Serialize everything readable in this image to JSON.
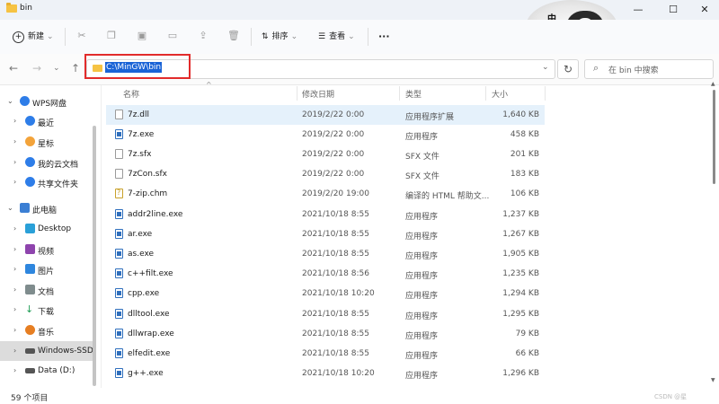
{
  "window": {
    "title": "bin",
    "minimize_glyph": "—",
    "maximize_glyph": "☐",
    "close_glyph": "✕"
  },
  "toolbar": {
    "new_label": "新建",
    "sort_label": "排序",
    "view_label": "查看",
    "more_label": "···"
  },
  "address": {
    "path": "C:\\MinGW\\bin",
    "search_placeholder": "在 bin 中搜索"
  },
  "avatar": {
    "char": "中",
    "small_text": "Ö"
  },
  "sidebar": {
    "items": [
      {
        "label": "WPS网盘",
        "icon": "cloud-icon",
        "expanded": true
      },
      {
        "label": "最近",
        "icon": "clock-icon"
      },
      {
        "label": "星标",
        "icon": "star-icon"
      },
      {
        "label": "我的云文档",
        "icon": "cloud-doc-icon"
      },
      {
        "label": "共享文件夹",
        "icon": "shared-folder-icon"
      },
      {
        "label": "此电脑",
        "icon": "computer-icon",
        "expanded": true
      },
      {
        "label": "Desktop",
        "icon": "desktop-icon"
      },
      {
        "label": "视频",
        "icon": "video-icon"
      },
      {
        "label": "图片",
        "icon": "picture-icon"
      },
      {
        "label": "文档",
        "icon": "document-icon"
      },
      {
        "label": "下载",
        "icon": "download-icon"
      },
      {
        "label": "音乐",
        "icon": "music-icon"
      },
      {
        "label": "Windows-SSD",
        "icon": "drive-icon",
        "selected": true
      },
      {
        "label": "Data (D:)",
        "icon": "drive-icon"
      }
    ]
  },
  "columns": {
    "name": "名称",
    "modified": "修改日期",
    "type": "类型",
    "size": "大小"
  },
  "files": [
    {
      "name": "7z.dll",
      "modified": "2019/2/22 0:00",
      "type": "应用程序扩展",
      "size": "1,640 KB",
      "icon": "dll-icon"
    },
    {
      "name": "7z.exe",
      "modified": "2019/2/22 0:00",
      "type": "应用程序",
      "size": "458 KB",
      "icon": "exe-icon"
    },
    {
      "name": "7z.sfx",
      "modified": "2019/2/22 0:00",
      "type": "SFX 文件",
      "size": "201 KB",
      "icon": "file-icon"
    },
    {
      "name": "7zCon.sfx",
      "modified": "2019/2/22 0:00",
      "type": "SFX 文件",
      "size": "183 KB",
      "icon": "file-icon"
    },
    {
      "name": "7-zip.chm",
      "modified": "2019/2/20 19:00",
      "type": "编译的 HTML 帮助文...",
      "size": "106 KB",
      "icon": "help-icon"
    },
    {
      "name": "addr2line.exe",
      "modified": "2021/10/18 8:55",
      "type": "应用程序",
      "size": "1,237 KB",
      "icon": "exe-icon"
    },
    {
      "name": "ar.exe",
      "modified": "2021/10/18 8:55",
      "type": "应用程序",
      "size": "1,267 KB",
      "icon": "exe-icon"
    },
    {
      "name": "as.exe",
      "modified": "2021/10/18 8:55",
      "type": "应用程序",
      "size": "1,905 KB",
      "icon": "exe-icon"
    },
    {
      "name": "c++filt.exe",
      "modified": "2021/10/18 8:56",
      "type": "应用程序",
      "size": "1,235 KB",
      "icon": "exe-icon"
    },
    {
      "name": "cpp.exe",
      "modified": "2021/10/18 10:20",
      "type": "应用程序",
      "size": "1,294 KB",
      "icon": "exe-icon"
    },
    {
      "name": "dlltool.exe",
      "modified": "2021/10/18 8:55",
      "type": "应用程序",
      "size": "1,295 KB",
      "icon": "exe-icon"
    },
    {
      "name": "dllwrap.exe",
      "modified": "2021/10/18 8:55",
      "type": "应用程序",
      "size": "79 KB",
      "icon": "exe-icon"
    },
    {
      "name": "elfedit.exe",
      "modified": "2021/10/18 8:55",
      "type": "应用程序",
      "size": "66 KB",
      "icon": "exe-icon"
    },
    {
      "name": "g++.exe",
      "modified": "2021/10/18 10:20",
      "type": "应用程序",
      "size": "1,296 KB",
      "icon": "exe-icon"
    }
  ],
  "status": {
    "count": "59 个项目",
    "watermark": "CSDN @星"
  },
  "colors": {
    "selection_bg": "#e5f1fb",
    "address_highlight": "#1a63d6",
    "annotation_box": "#e22b2b"
  }
}
